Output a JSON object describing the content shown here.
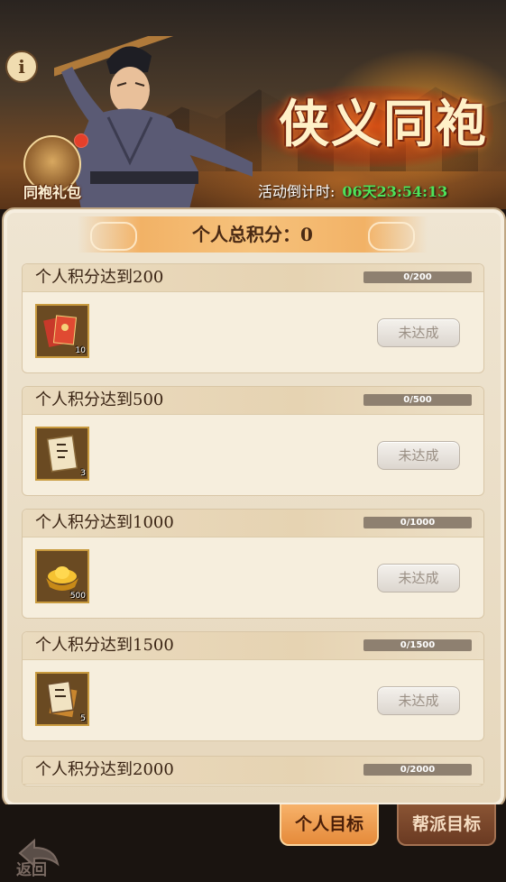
{
  "banner": {
    "event_title": "侠义同袍",
    "gift_label": "同袍礼包",
    "info_glyph": "i",
    "countdown_label": "活动倒计时:",
    "countdown_time": "06天23:54:13"
  },
  "score": {
    "label": "个人总积分：0"
  },
  "goals": [
    {
      "title": "个人积分达到200",
      "progress_text": "0/200",
      "progress": 0,
      "item_icon": "red-envelope-bundle-icon",
      "qty": "10",
      "status": "未达成"
    },
    {
      "title": "个人积分达到500",
      "progress_text": "0/500",
      "progress": 0,
      "item_icon": "scroll-note-icon",
      "qty": "3",
      "status": "未达成"
    },
    {
      "title": "个人积分达到1000",
      "progress_text": "0/1000",
      "progress": 0,
      "item_icon": "gold-ingot-icon",
      "qty": "500",
      "status": "未达成"
    },
    {
      "title": "个人积分达到1500",
      "progress_text": "0/1500",
      "progress": 0,
      "item_icon": "scroll-bundle-icon",
      "qty": "5",
      "status": "未达成"
    },
    {
      "title": "个人积分达到2000",
      "progress_text": "0/2000",
      "progress": 0
    }
  ],
  "tabs": {
    "personal": "个人目标",
    "guild": "帮派目标"
  },
  "back_label": "返回",
  "colors": {
    "countdown_time": "#4fe35a",
    "active_tab": "#e58a3a",
    "inactive_tab": "#6a3a22",
    "progress_fill": "#e9a13b"
  }
}
